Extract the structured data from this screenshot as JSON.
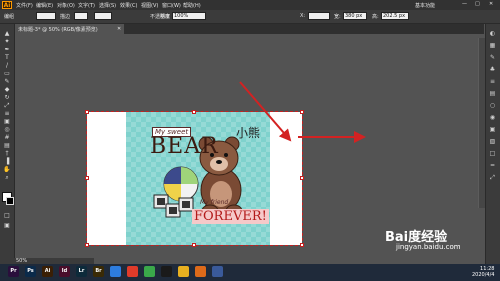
{
  "app": {
    "logo": "Ai"
  },
  "menubar": {
    "items": [
      "文件(F)",
      "编辑(E)",
      "对象(O)",
      "文字(T)",
      "选择(S)",
      "效果(C)",
      "视图(V)",
      "窗口(W)",
      "帮助(H)"
    ],
    "workspace": "基本功能",
    "window_buttons": [
      "—",
      "□",
      "✕"
    ]
  },
  "controlbar": {
    "selection_label": "编组",
    "stroke_label": "描边",
    "style_label": "不透明度",
    "opacity_value": "100%",
    "basic_label": "基本",
    "x_label": "X:",
    "w_label": "宽:",
    "w_value": "380 px",
    "h_label": "高:",
    "h_value": "202.5 px"
  },
  "document": {
    "tab_title": "未标题-3* @ 50% (RGB/像素预览)",
    "close": "✕",
    "zoom": "50%"
  },
  "artwork": {
    "chinese_label": "小熊",
    "my_sweet": "My sweet",
    "bear": "BEAR",
    "my_friend": "My friend",
    "forever": "FOREVER!"
  },
  "tools": {
    "left": [
      "selection-tool",
      "direct-selection-tool",
      "magic-wand-tool",
      "lasso-tool",
      "pen-tool",
      "type-tool",
      "line-tool",
      "rectangle-tool",
      "paintbrush-tool",
      "pencil-tool",
      "eraser-tool",
      "rotate-tool",
      "scale-tool",
      "width-tool",
      "free-transform-tool",
      "shape-builder-tool",
      "perspective-tool",
      "mesh-tool",
      "gradient-tool",
      "eyedropper-tool",
      "blend-tool",
      "symbol-sprayer-tool",
      "graph-tool",
      "artboard-tool",
      "slice-tool",
      "hand-tool",
      "zoom-tool"
    ],
    "right": [
      "color-panel",
      "swatches-panel",
      "brushes-panel",
      "symbols-panel",
      "stroke-panel",
      "gradient-panel",
      "transparency-panel",
      "appearance-panel",
      "graphic-styles-panel",
      "layers-panel",
      "artboards-panel",
      "align-panel",
      "transform-panel"
    ]
  },
  "taskbar": {
    "apps": [
      {
        "label": "Pr",
        "color": "#2a0f3c"
      },
      {
        "label": "Ps",
        "color": "#0b2a4a"
      },
      {
        "label": "Ai",
        "color": "#3a1f05"
      },
      {
        "label": "Id",
        "color": "#4a0e2b"
      },
      {
        "label": "Lr",
        "color": "#0d2a3a"
      },
      {
        "label": "Br",
        "color": "#3a2a05"
      },
      {
        "label": "",
        "color": "#2d7de0"
      },
      {
        "label": "",
        "color": "#e03b2a"
      },
      {
        "label": "",
        "color": "#3aa84a"
      },
      {
        "label": "",
        "color": "#1a1a1a"
      },
      {
        "label": "",
        "color": "#e8b020"
      },
      {
        "label": "",
        "color": "#dd6a1a"
      },
      {
        "label": "",
        "color": "#3a5a9a"
      }
    ],
    "time": "11:28",
    "date": "2020/4/4"
  },
  "watermark": {
    "brand": "Bai度经验",
    "url": "jingyan.baidu.com"
  },
  "colors": {
    "selection": "#c62020",
    "arrow": "#d32222",
    "pattern_bg": "#7fd2cd"
  }
}
